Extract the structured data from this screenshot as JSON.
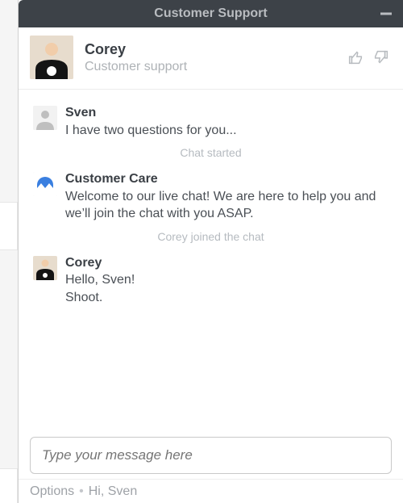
{
  "title": "Customer Support",
  "agent": {
    "name": "Corey",
    "role": "Customer support"
  },
  "messages": {
    "m0": {
      "name": "Sven",
      "text": "I have two questions for you..."
    },
    "sys0": "Chat started",
    "m1": {
      "name": "Customer Care",
      "text": "Welcome to our live chat! We are here to help you and we’ll join the chat with you ASAP."
    },
    "sys1": "Corey joined the chat",
    "m2": {
      "name": "Corey",
      "line1": "Hello, Sven!",
      "line2": "Shoot."
    }
  },
  "composer": {
    "placeholder": "Type your message here"
  },
  "footer": {
    "options": "Options",
    "greeting": "Hi, Sven"
  }
}
